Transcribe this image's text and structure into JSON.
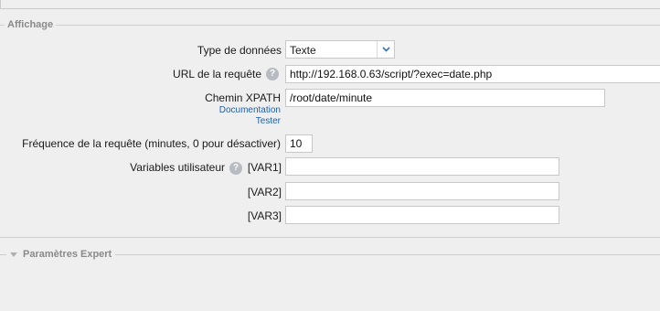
{
  "section": {
    "legend": "Affichage"
  },
  "fields": {
    "type": {
      "label": "Type de données",
      "value": "Texte"
    },
    "url": {
      "label": "URL de la requête",
      "value": "http://192.168.0.63/script/?exec=date.php"
    },
    "xpath": {
      "label": "Chemin XPATH",
      "value": "/root/date/minute",
      "doc_link": "Documentation",
      "test_link": "Tester"
    },
    "frequency": {
      "label": "Fréquence de la requête (minutes, 0 pour désactiver)",
      "value": "10"
    },
    "variables": {
      "label": "Variables utilisateur",
      "items": [
        {
          "name": "[VAR1]",
          "value": ""
        },
        {
          "name": "[VAR2]",
          "value": ""
        },
        {
          "name": "[VAR3]",
          "value": ""
        }
      ]
    }
  },
  "expert": {
    "legend": "Paramètres Expert"
  },
  "icons": {
    "help": "help-icon",
    "chevron": "chevron-down-icon",
    "collapse": "triangle-down-icon"
  }
}
